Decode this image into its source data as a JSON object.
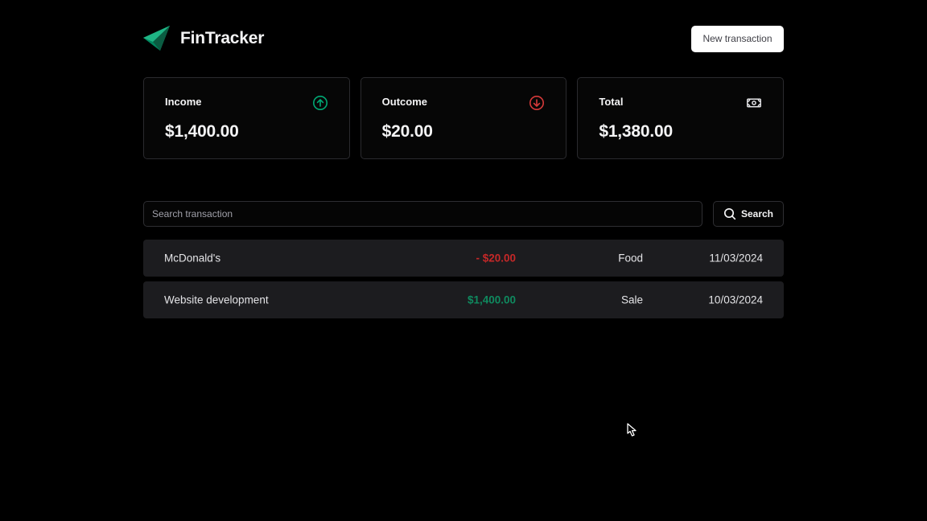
{
  "header": {
    "app_name": "FinTracker",
    "logo_icon": "paper-plane-logo-icon",
    "new_transaction_label": "New transaction"
  },
  "summary": {
    "income": {
      "title": "Income",
      "value": "$1,400.00",
      "icon": "arrow-circle-up-icon",
      "color": "#00b37e"
    },
    "outcome": {
      "title": "Outcome",
      "value": "$20.00",
      "icon": "arrow-circle-down-icon",
      "color": "#f75a68"
    },
    "total": {
      "title": "Total",
      "value": "$1,380.00",
      "icon": "money-icon"
    }
  },
  "search": {
    "placeholder": "Search transaction",
    "value": "",
    "button_label": "Search",
    "icon": "search-icon"
  },
  "transactions": [
    {
      "description": "McDonald's",
      "amount": "- $20.00",
      "type": "outcome",
      "category": "Food",
      "date": "11/03/2024"
    },
    {
      "description": "Website development",
      "amount": "$1,400.00",
      "type": "income",
      "category": "Sale",
      "date": "10/03/2024"
    }
  ],
  "colors": {
    "background": "#000000",
    "accent": "#00875f",
    "income": "#0f8a5f",
    "outcome": "#c62828",
    "row_background": "#1c1c1f"
  }
}
